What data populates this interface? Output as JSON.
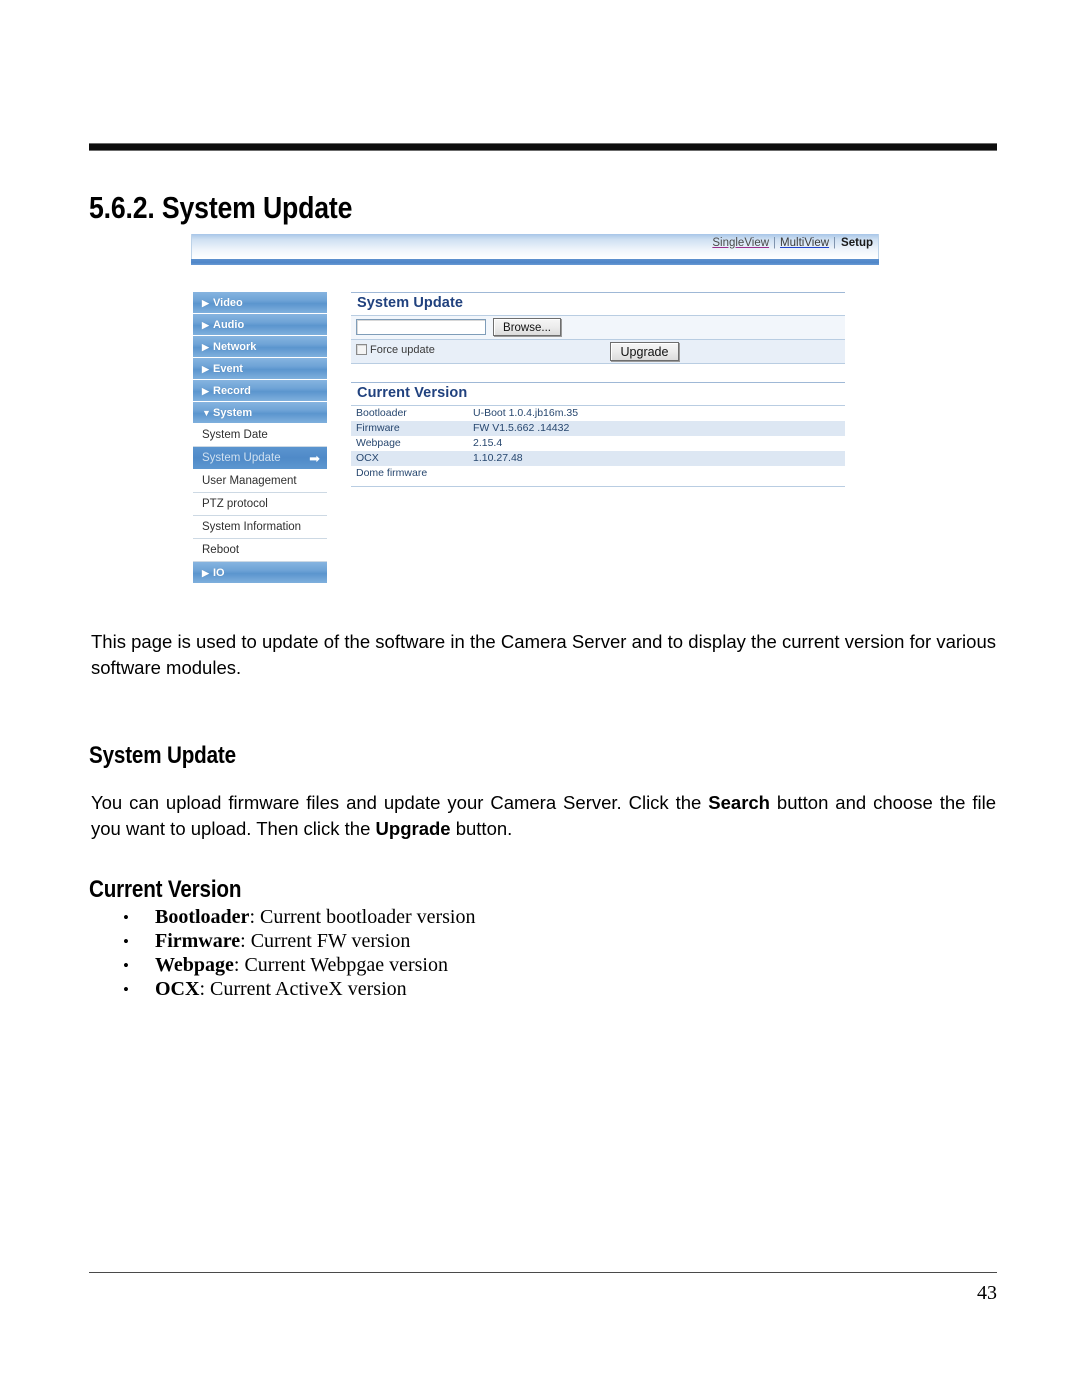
{
  "document": {
    "page_number": "43",
    "section_heading": "5.6.2. System Update",
    "sub_heading_1": "System Update",
    "sub_heading_2": "Current Version",
    "paragraph_intro": "This page is used to update of the software in the Camera Server and to display the current version for various software modules.",
    "paragraph_upload_part1": "You can upload firmware files and update your Camera Server.  Click the ",
    "paragraph_upload_bold1": "Search",
    "paragraph_upload_part2": " button and choose the file you want to upload.  Then click the ",
    "paragraph_upload_bold2": "Upgrade",
    "paragraph_upload_part3": " button.",
    "bullets": [
      {
        "term": "Bootloader",
        "desc": ": Current bootloader version"
      },
      {
        "term": "Firmware",
        "desc": ": Current FW version"
      },
      {
        "term": "Webpage",
        "desc": ": Current Webpgae version"
      },
      {
        "term": "OCX",
        "desc": ": Current ActiveX version"
      }
    ]
  },
  "screenshot": {
    "nav": {
      "single_view": "SingleView",
      "multi_view": "MultiView",
      "setup": "Setup",
      "separator": "|"
    },
    "sidebar": {
      "categories": [
        {
          "label": "Video",
          "glyph": "▶"
        },
        {
          "label": "Audio",
          "glyph": "▶"
        },
        {
          "label": "Network",
          "glyph": "▶"
        },
        {
          "label": "Event",
          "glyph": "▶"
        },
        {
          "label": "Record",
          "glyph": "▶"
        },
        {
          "label": "System",
          "glyph": "▼"
        }
      ],
      "system_items": [
        {
          "label": "System Date"
        },
        {
          "label": "System Update"
        },
        {
          "label": "User Management"
        },
        {
          "label": "PTZ protocol"
        },
        {
          "label": "System Information"
        },
        {
          "label": "Reboot"
        }
      ],
      "selected_item": "System Update",
      "selected_arrow_glyph": "➡",
      "io": {
        "label": "IO",
        "glyph": "▶"
      }
    },
    "panel": {
      "system_update_title": "System Update",
      "file_input_value": "",
      "browse_label": "Browse...",
      "force_update_label": "Force update",
      "force_update_checked": false,
      "upgrade_label": "Upgrade",
      "current_version_title": "Current Version",
      "version_rows": [
        {
          "name": "Bootloader",
          "value": "U-Boot 1.0.4.jb16m.35"
        },
        {
          "name": "Firmware",
          "value": "FW V1.5.662 .14432"
        },
        {
          "name": "Webpage",
          "value": "2.15.4"
        },
        {
          "name": "OCX",
          "value": "1.10.27.48"
        },
        {
          "name": "Dome firmware",
          "value": ""
        }
      ]
    },
    "colors": {
      "panel_title": "#20417e",
      "sidebar_blue": "#5b95ce",
      "row_alt": "#dde7f3",
      "nav_underbar": "#4f86c8"
    }
  }
}
